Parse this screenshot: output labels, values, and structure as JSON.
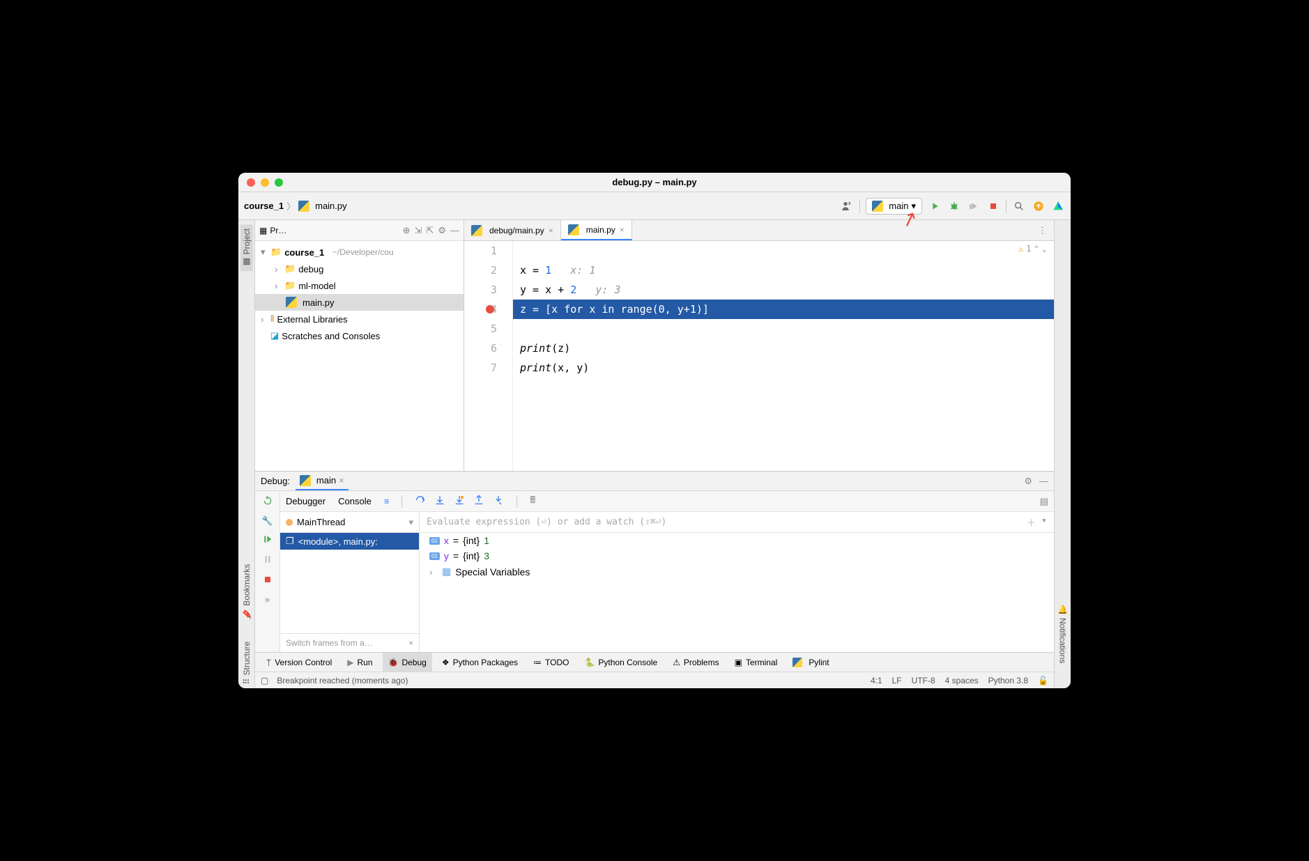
{
  "title": "debug.py – main.py",
  "breadcrumb": {
    "root": "course_1",
    "file": "main.py"
  },
  "run_config": "main",
  "editor": {
    "tabs": [
      {
        "label": "debug/main.py",
        "active": false
      },
      {
        "label": "main.py",
        "active": true
      }
    ],
    "warnings": "1",
    "lines": [
      {
        "n": "1",
        "code": ""
      },
      {
        "n": "2",
        "code": "x = ",
        "num": "1",
        "hint": "x: 1"
      },
      {
        "n": "3",
        "code": "y = x + ",
        "num": "2",
        "hint": "y: 3"
      },
      {
        "n": "4",
        "code": "z = [x for x in range(0, y+1)]",
        "hl": true,
        "bp": true
      },
      {
        "n": "5",
        "code": ""
      },
      {
        "n": "6",
        "code_a": "print",
        "code_b": "(z)"
      },
      {
        "n": "7",
        "code_a": "print",
        "code_b": "(x, y)"
      }
    ]
  },
  "project": {
    "label": "Pr…",
    "root": "course_1",
    "root_path": "~/Developer/cou",
    "children": [
      {
        "name": "debug",
        "type": "folder"
      },
      {
        "name": "ml-model",
        "type": "folder"
      },
      {
        "name": "main.py",
        "type": "py",
        "sel": true
      }
    ],
    "ext": "External Libraries",
    "scratch": "Scratches and Consoles"
  },
  "debug": {
    "label": "Debug:",
    "config": "main",
    "tabs": {
      "debugger": "Debugger",
      "console": "Console"
    },
    "thread": "MainThread",
    "frame": "<module>, main.py:",
    "frames_hint": "Switch frames from a…",
    "watch_placeholder": "Evaluate expression (⏎) or add a watch (⇧⌘⏎)",
    "vars": [
      {
        "name": "x",
        "type": "{int}",
        "val": "1"
      },
      {
        "name": "y",
        "type": "{int}",
        "val": "3"
      }
    ],
    "special": "Special Variables"
  },
  "tools": {
    "version": "Version Control",
    "run": "Run",
    "debug": "Debug",
    "packages": "Python Packages",
    "todo": "TODO",
    "console": "Python Console",
    "problems": "Problems",
    "terminal": "Terminal",
    "pylint": "Pylint"
  },
  "rails": {
    "project": "Project",
    "bookmarks": "Bookmarks",
    "structure": "Structure",
    "notifications": "Notifications"
  },
  "status": {
    "msg": "Breakpoint reached (moments ago)",
    "pos": "4:1",
    "lf": "LF",
    "enc": "UTF-8",
    "indent": "4 spaces",
    "sdk": "Python 3.8"
  }
}
